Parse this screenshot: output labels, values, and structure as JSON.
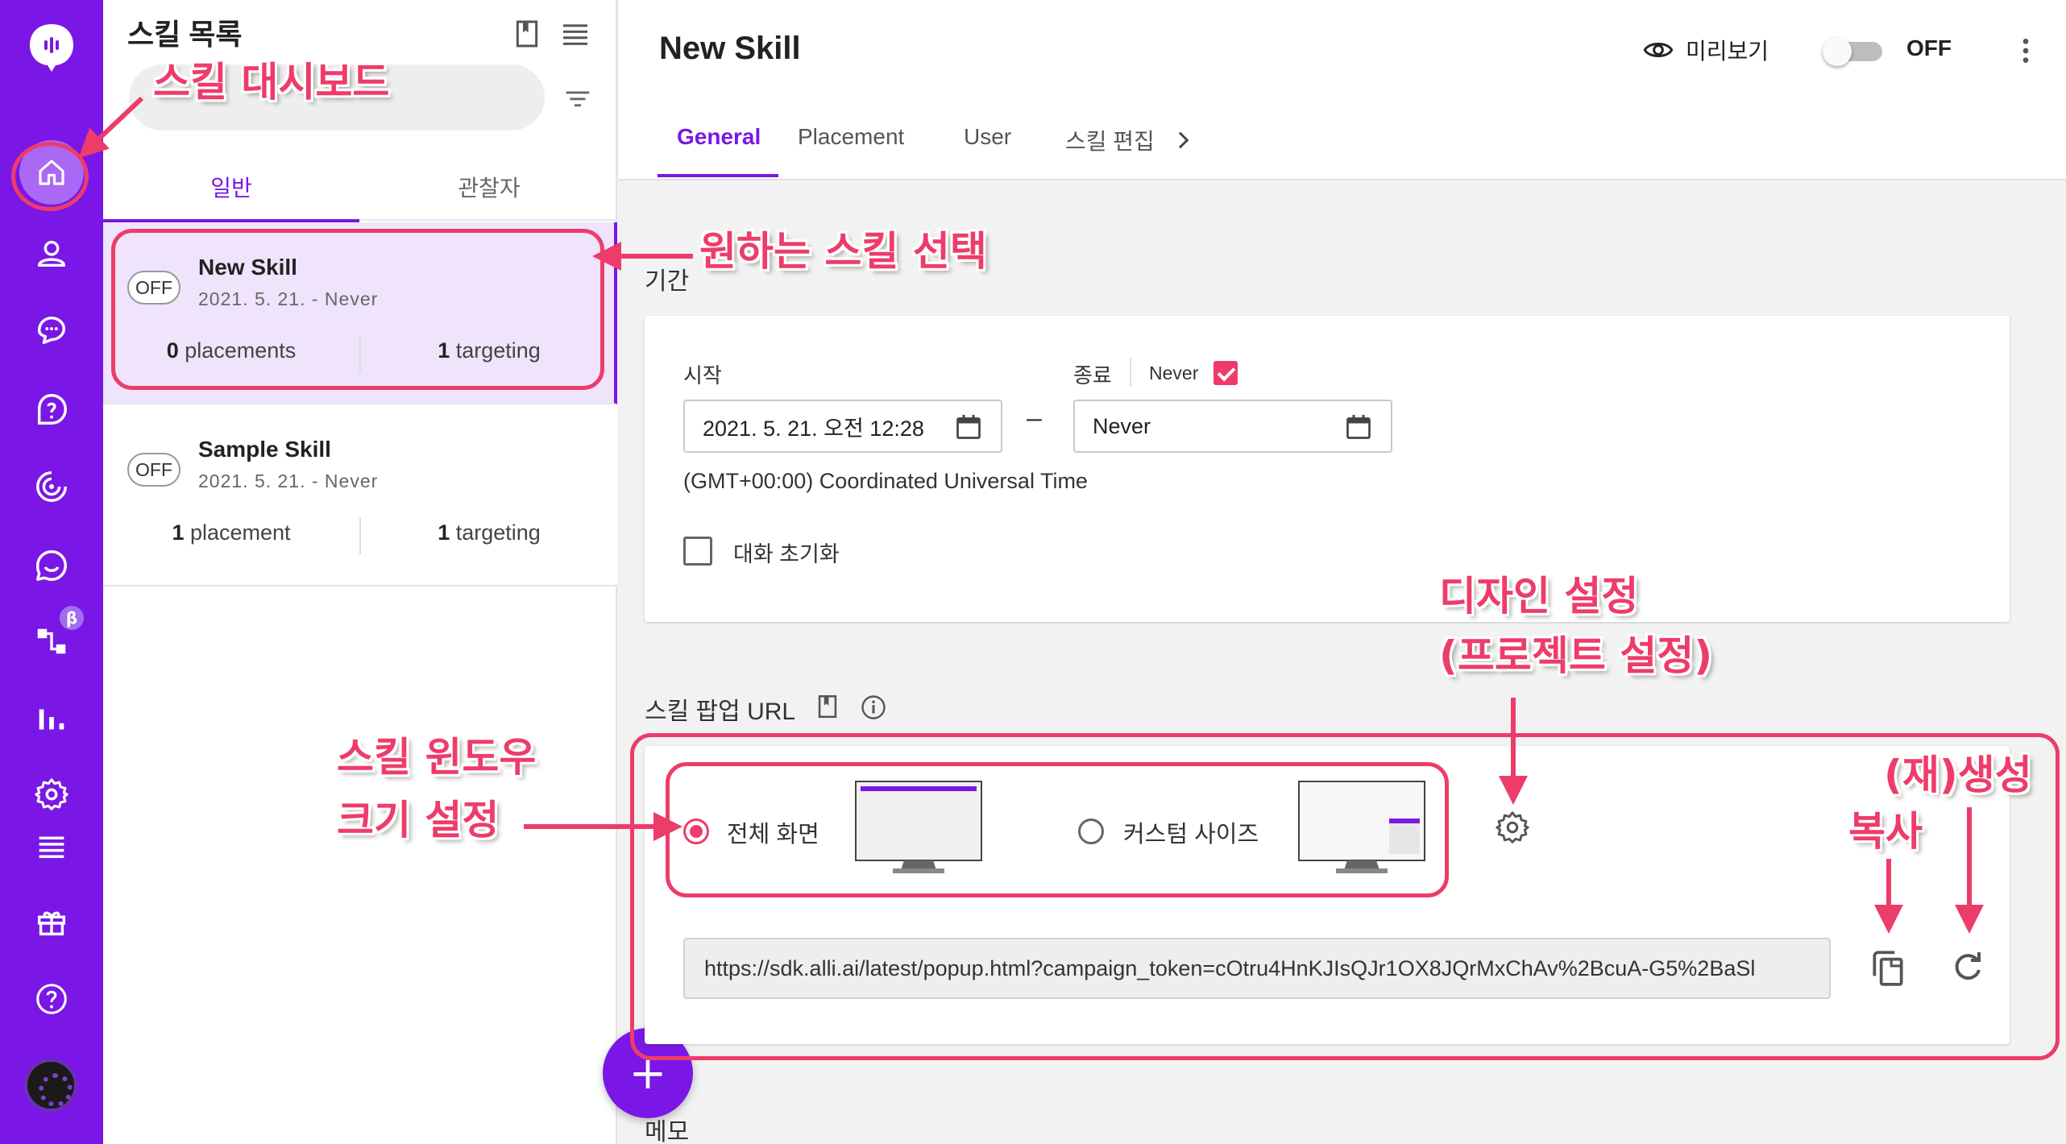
{
  "rail": {
    "items": [
      {
        "name": "dashboard",
        "icon": "home-icon",
        "active": true
      },
      {
        "name": "users",
        "icon": "user-icon"
      },
      {
        "name": "conversations",
        "icon": "chat-bubbles-icon"
      },
      {
        "name": "faq",
        "icon": "question-bubble-icon"
      },
      {
        "name": "campaign",
        "icon": "target-icon"
      },
      {
        "name": "chat",
        "icon": "chat-smile-icon"
      },
      {
        "name": "workflow",
        "icon": "flow-icon"
      },
      {
        "name": "analytics",
        "icon": "bar-chart-icon"
      },
      {
        "name": "settings",
        "icon": "gear-icon"
      },
      {
        "name": "list",
        "icon": "list-icon"
      },
      {
        "name": "gift",
        "icon": "gift-icon"
      },
      {
        "name": "help",
        "icon": "help-icon"
      }
    ],
    "beta_label": "β"
  },
  "skill_list": {
    "title": "스킬 목록",
    "tabs": [
      "일반",
      "관찰자"
    ],
    "active_tab": "일반",
    "skills": [
      {
        "status": "OFF",
        "name": "New Skill",
        "date": "2021. 5. 21. - Never",
        "placements_count": "0",
        "placements_label": "placements",
        "targeting_count": "1",
        "targeting_label": "targeting",
        "selected": true
      },
      {
        "status": "OFF",
        "name": "Sample Skill",
        "date": "2021. 5. 21. - Never",
        "placements_count": "1",
        "placements_label": "placement",
        "targeting_count": "1",
        "targeting_label": "targeting",
        "selected": false
      }
    ],
    "add_button": "+"
  },
  "header": {
    "title": "New Skill",
    "preview_label": "미리보기",
    "toggle_state": "OFF",
    "tabs": [
      "General",
      "Placement",
      "User",
      "스킬 편집"
    ],
    "active_tab": "General"
  },
  "period": {
    "section_label": "기간",
    "start_label": "시작",
    "end_label": "종료",
    "never_label": "Never",
    "never_checked": true,
    "start_value": "2021. 5. 21. 오전 12:28",
    "end_value": "Never",
    "range_separator": "–",
    "timezone": "(GMT+00:00) Coordinated Universal Time",
    "reset_conversation_label": "대화 초기화",
    "reset_conversation_checked": false
  },
  "popup_url": {
    "section_label": "스킬 팝업 URL",
    "options": [
      {
        "label": "전체 화면",
        "selected": true
      },
      {
        "label": "커스텀 사이즈",
        "selected": false
      }
    ],
    "url": "https://sdk.alli.ai/latest/popup.html?campaign_token=cOtru4HnKJIsQJr1OX8JQrMxChAv%2BcuA-G5%2BaSl"
  },
  "memo": {
    "section_label": "메모"
  },
  "annotations": {
    "dashboard": "스킬 대시보드",
    "select_skill": "원하는 스킬 선택",
    "design_line1": "디자인 설정",
    "design_line2": "(프로젝트 설정)",
    "window_size_line1": "스킬 윈도우",
    "window_size_line2": "크기 설정",
    "regenerate": "(재)생성",
    "copy": "복사"
  },
  "colors": {
    "brand": "#7a17e6",
    "annotation": "#ee3c6a"
  }
}
